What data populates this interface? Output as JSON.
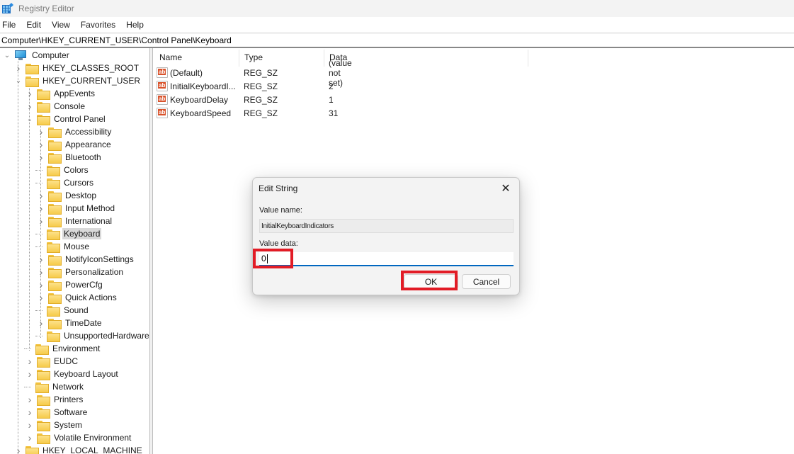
{
  "window": {
    "title": "Registry Editor",
    "icon": "registry-editor-icon"
  },
  "menu": [
    "File",
    "Edit",
    "View",
    "Favorites",
    "Help"
  ],
  "address": "Computer\\HKEY_CURRENT_USER\\Control Panel\\Keyboard",
  "tree": {
    "root": "Computer",
    "items": [
      {
        "label": "HKEY_CLASSES_ROOT",
        "expander": "collapsed"
      },
      {
        "label": "HKEY_CURRENT_USER",
        "expander": "expanded"
      },
      {
        "label": "AppEvents",
        "expander": "collapsed"
      },
      {
        "label": "Console",
        "expander": "collapsed"
      },
      {
        "label": "Control Panel",
        "expander": "expanded"
      },
      {
        "label": "Accessibility",
        "expander": "collapsed"
      },
      {
        "label": "Appearance",
        "expander": "collapsed"
      },
      {
        "label": "Bluetooth",
        "expander": "collapsed"
      },
      {
        "label": "Colors",
        "expander": "none"
      },
      {
        "label": "Cursors",
        "expander": "none"
      },
      {
        "label": "Desktop",
        "expander": "collapsed"
      },
      {
        "label": "Input Method",
        "expander": "collapsed"
      },
      {
        "label": "International",
        "expander": "collapsed"
      },
      {
        "label": "Keyboard",
        "expander": "none",
        "selected": true
      },
      {
        "label": "Mouse",
        "expander": "none"
      },
      {
        "label": "NotifyIconSettings",
        "expander": "collapsed"
      },
      {
        "label": "Personalization",
        "expander": "collapsed"
      },
      {
        "label": "PowerCfg",
        "expander": "collapsed"
      },
      {
        "label": "Quick Actions",
        "expander": "collapsed"
      },
      {
        "label": "Sound",
        "expander": "none"
      },
      {
        "label": "TimeDate",
        "expander": "collapsed"
      },
      {
        "label": "UnsupportedHardwareN",
        "expander": "none"
      },
      {
        "label": "Environment",
        "expander": "none"
      },
      {
        "label": "EUDC",
        "expander": "collapsed"
      },
      {
        "label": "Keyboard Layout",
        "expander": "collapsed"
      },
      {
        "label": "Network",
        "expander": "none"
      },
      {
        "label": "Printers",
        "expander": "collapsed"
      },
      {
        "label": "Software",
        "expander": "collapsed"
      },
      {
        "label": "System",
        "expander": "collapsed"
      },
      {
        "label": "Volatile Environment",
        "expander": "collapsed"
      },
      {
        "label": "HKEY_LOCAL_MACHINE",
        "expander": "collapsed"
      }
    ]
  },
  "list": {
    "columns": [
      "Name",
      "Type",
      "Data"
    ],
    "rows": [
      {
        "name": "(Default)",
        "type": "REG_SZ",
        "data": "(value not set)"
      },
      {
        "name": "InitialKeyboardI...",
        "type": "REG_SZ",
        "data": "2"
      },
      {
        "name": "KeyboardDelay",
        "type": "REG_SZ",
        "data": "1"
      },
      {
        "name": "KeyboardSpeed",
        "type": "REG_SZ",
        "data": "31"
      }
    ]
  },
  "dialog": {
    "title": "Edit String",
    "close_glyph": "✕",
    "value_name_label": "Value name:",
    "value_name": "InitialKeyboardIndicators",
    "value_data_label": "Value data:",
    "value_data": "0",
    "ok_label": "OK",
    "cancel_label": "Cancel"
  },
  "annotations": {
    "highlight_color": "#e21c26",
    "highlighted": [
      "value-data-input",
      "ok-button"
    ]
  }
}
